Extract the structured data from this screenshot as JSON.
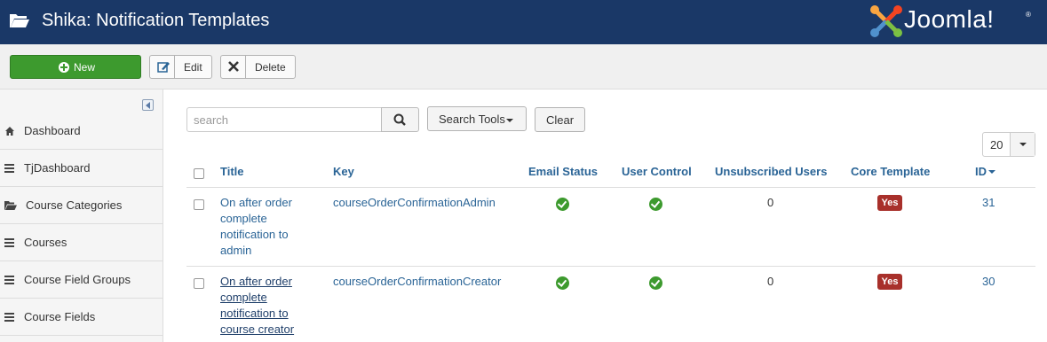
{
  "header": {
    "title": "Shika: Notification Templates",
    "brand": "Joomla!",
    "brand_reg": "®"
  },
  "toolbar": {
    "new_label": "New",
    "edit_label": "Edit",
    "delete_label": "Delete"
  },
  "sidebar": {
    "items": [
      {
        "label": "Dashboard",
        "icon": "home-icon"
      },
      {
        "label": "TjDashboard",
        "icon": "list-icon"
      },
      {
        "label": "Course Categories",
        "icon": "folder-open-icon"
      },
      {
        "label": "Courses",
        "icon": "list-icon"
      },
      {
        "label": "Course Field Groups",
        "icon": "list-icon"
      },
      {
        "label": "Course Fields",
        "icon": "list-icon"
      }
    ]
  },
  "filters": {
    "search_placeholder": "search",
    "search_tools_label": "Search Tools",
    "clear_label": "Clear",
    "limit_value": "20"
  },
  "table": {
    "headers": {
      "title": "Title",
      "key": "Key",
      "email_status": "Email Status",
      "user_control": "User Control",
      "unsubscribed": "Unsubscribed Users",
      "core_template": "Core Template",
      "id": "ID"
    },
    "sort_column": "ID",
    "rows": [
      {
        "title": "On after order complete notification to admin",
        "key": "courseOrderConfirmationAdmin",
        "email_status": true,
        "user_control": true,
        "unsubscribed": "0",
        "core": "Yes",
        "id": "31"
      },
      {
        "title": "On after order complete notification to course creator",
        "key": "courseOrderConfirmationCreator",
        "email_status": true,
        "user_control": true,
        "unsubscribed": "0",
        "core": "Yes",
        "id": "30"
      }
    ]
  },
  "colors": {
    "header_bg": "#1a3867",
    "new_button": "#3d9a2e",
    "link": "#2a6496",
    "badge": "#a8302b",
    "check": "#3d9a2e"
  }
}
